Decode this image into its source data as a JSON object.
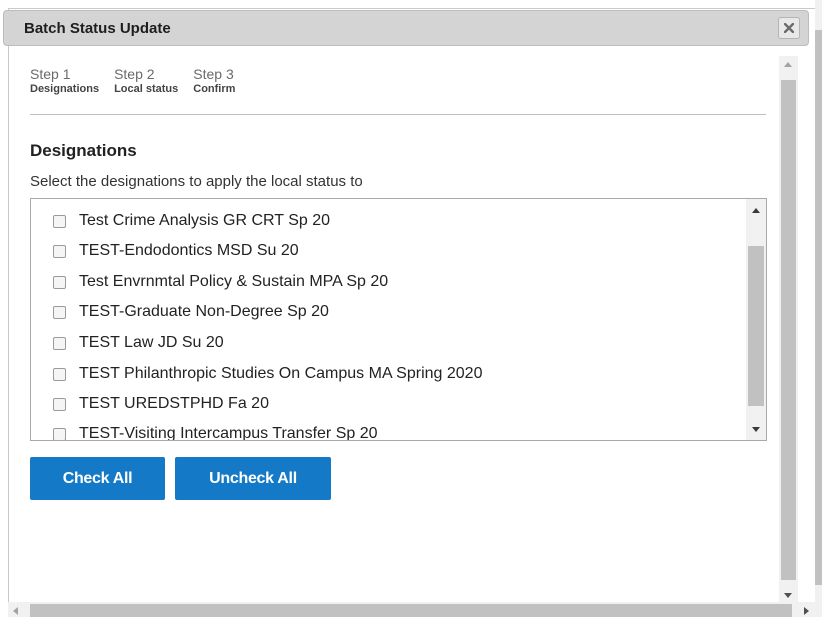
{
  "dialog": {
    "title": "Batch Status Update"
  },
  "steps": [
    {
      "num": "Step 1",
      "name": "Designations"
    },
    {
      "num": "Step 2",
      "name": "Local status"
    },
    {
      "num": "Step 3",
      "name": "Confirm"
    }
  ],
  "section": {
    "title": "Designations",
    "description": "Select the designations to apply the local status to"
  },
  "designations": [
    {
      "label": "Test Crime Analysis GR CRT Sp 20",
      "checked": false
    },
    {
      "label": "TEST-Endodontics MSD Su 20",
      "checked": false
    },
    {
      "label": "Test Envrnmtal Policy & Sustain MPA Sp 20",
      "checked": false
    },
    {
      "label": "TEST-Graduate Non-Degree Sp 20",
      "checked": false
    },
    {
      "label": "TEST Law JD Su 20",
      "checked": false
    },
    {
      "label": "TEST Philanthropic Studies On Campus MA Spring 2020",
      "checked": false
    },
    {
      "label": "TEST UREDSTPHD Fa 20",
      "checked": false
    },
    {
      "label": "TEST-Visiting Intercampus Transfer Sp 20",
      "checked": false
    }
  ],
  "buttons": {
    "check_all": "Check All",
    "uncheck_all": "Uncheck All"
  },
  "colors": {
    "primary_button": "#1479c6",
    "titlebar": "#d4d4d4"
  },
  "icons": {
    "close": "close-icon"
  }
}
